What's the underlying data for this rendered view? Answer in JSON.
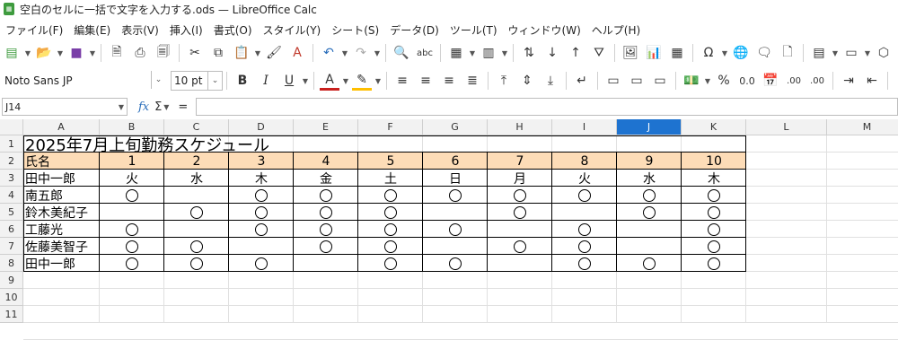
{
  "window": {
    "title": "空白のセルに一括で文字を入力する.ods — LibreOffice Calc",
    "app_icon": "calc-icon"
  },
  "menu": [
    "ファイル(F)",
    "編集(E)",
    "表示(V)",
    "挿入(I)",
    "書式(O)",
    "スタイル(Y)",
    "シート(S)",
    "データ(D)",
    "ツール(T)",
    "ウィンドウ(W)",
    "ヘルプ(H)"
  ],
  "format_bar": {
    "font_name": "Noto Sans JP",
    "font_size": "10 pt",
    "bold": "B",
    "italic": "I",
    "underline": "U",
    "percent": "%",
    "decimal_add": ".00",
    "decimal_remove": ".00"
  },
  "formula_bar": {
    "name_box": "J14",
    "fx": "fx",
    "sigma": "Σ",
    "equals": "=",
    "input": ""
  },
  "columns": [
    "A",
    "B",
    "C",
    "D",
    "E",
    "F",
    "G",
    "H",
    "I",
    "J",
    "K",
    "L",
    "M"
  ],
  "selected_column": "J",
  "rows": [
    "1",
    "2",
    "3",
    "4",
    "5",
    "6",
    "7",
    "8",
    "9",
    "10",
    "11"
  ],
  "sheet": {
    "title": "2025年7月上旬勤務スケジュール",
    "name_header": "氏名",
    "days": [
      "1",
      "2",
      "3",
      "4",
      "5",
      "6",
      "7",
      "8",
      "9",
      "10"
    ],
    "weekdays": [
      "火",
      "水",
      "木",
      "金",
      "土",
      "日",
      "月",
      "火",
      "水",
      "木"
    ],
    "header_fill_color": "#fddcb7",
    "schedule": [
      {
        "name": "田中一郎",
        "marks": [
          0,
          0,
          0,
          0,
          0,
          0,
          0,
          0,
          0,
          0
        ]
      },
      {
        "name": "南五郎",
        "marks": [
          1,
          0,
          1,
          1,
          1,
          1,
          1,
          1,
          1,
          1
        ]
      },
      {
        "name": "鈴木美紀子",
        "marks": [
          0,
          1,
          1,
          1,
          1,
          0,
          1,
          0,
          1,
          1
        ]
      },
      {
        "name": "工藤光",
        "marks": [
          1,
          0,
          1,
          1,
          1,
          1,
          0,
          1,
          0,
          1
        ]
      },
      {
        "name": "佐藤美智子",
        "marks": [
          1,
          1,
          0,
          1,
          1,
          0,
          1,
          1,
          0,
          1
        ]
      },
      {
        "name": "田中一郎",
        "marks": [
          1,
          1,
          1,
          0,
          1,
          1,
          0,
          1,
          1,
          1
        ]
      }
    ]
  }
}
